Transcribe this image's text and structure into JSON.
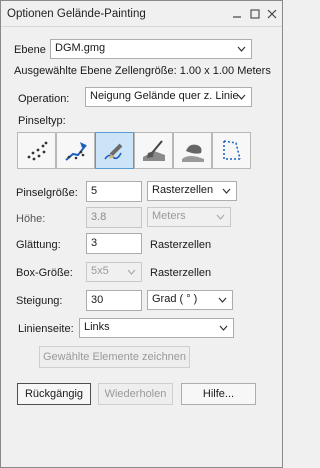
{
  "window": {
    "title": "Optionen Gelände-Painting",
    "controls": [
      "minimize-icon",
      "maximize-icon",
      "close-icon"
    ]
  },
  "layer": {
    "label": "Ebene",
    "value": "DGM.gmg",
    "cell_size_text": "Ausgewählte Ebene Zellengröße: 1.00 x 1.00 Meters"
  },
  "operation": {
    "label": "Operation:",
    "value": "Neigung Gelände quer z. Linie"
  },
  "brush_type": {
    "label": "Pinseltyp:",
    "tools": [
      {
        "icon": "spray-dots-icon",
        "active": false
      },
      {
        "icon": "line-path-icon",
        "active": false
      },
      {
        "icon": "pencil-stroke-icon",
        "active": true
      },
      {
        "icon": "shovel-terrain-icon",
        "active": false
      },
      {
        "icon": "smooth-terrain-icon",
        "active": false
      },
      {
        "icon": "dotted-area-icon",
        "active": false
      }
    ]
  },
  "brush_size": {
    "label": "Pinselgröße:",
    "value": "5",
    "unit": "Rasterzellen"
  },
  "height": {
    "label": "Höhe:",
    "value": "3.8",
    "unit": "Meters"
  },
  "smoothing": {
    "label": "Glättung:",
    "value": "3",
    "unit": "Rasterzellen"
  },
  "box_size": {
    "label": "Box-Größe:",
    "value": "5x5",
    "unit": "Rasterzellen"
  },
  "slope": {
    "label": "Steigung:",
    "value": "30",
    "unit": "Grad ( ° )"
  },
  "line_side": {
    "label": "Linienseite:",
    "value": "Links"
  },
  "buttons": {
    "draw_selected": "Gewählte Elemente zeichnen",
    "undo": "Rückgängig",
    "redo": "Wiederholen",
    "help": "Hilfe..."
  },
  "colors": {
    "active_tool_bg": "#cce4f7",
    "active_tool_border": "#5a9bd5",
    "tool_icon_blue": "#1f5fbf"
  }
}
